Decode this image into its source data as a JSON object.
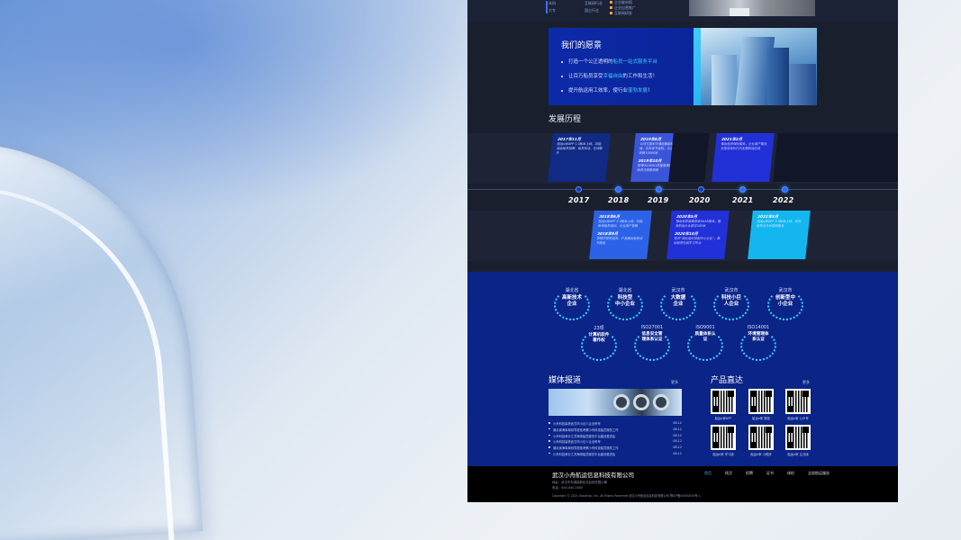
{
  "top": {
    "left_items": [
      "本科",
      "大专"
    ],
    "mid_items": [
      "互联网行业",
      "国企行业"
    ],
    "right_items": [
      "企业能申报",
      "企业自营推广",
      "互联网研发"
    ]
  },
  "vision": {
    "title": "我们的愿景",
    "items": [
      {
        "pre": "打造一个公正透明的",
        "hl": "船员一站式服务平台",
        "post": ""
      },
      {
        "pre": "让百万船员享受",
        "hl": "幸福自由",
        "post": "的工作和生活！"
      },
      {
        "pre": "提升航运用工效率，使行业",
        "hl": "蓬勃发展",
        "post": "！"
      }
    ]
  },
  "history": {
    "title": "发展历程",
    "years": [
      "2017",
      "2018",
      "2019",
      "2020",
      "2021",
      "2022"
    ],
    "top_cards": [
      {
        "lines": [
          {
            "date": "2017年11月",
            "text": "船运e家APP 1.0版本上线，功能涵盖船员招聘、船员找活、在线聊天"
          },
          {
            "date": "",
            "text": ""
          }
        ]
      },
      {
        "lines": [
          {
            "date": "2019年6月",
            "text": "公司与国家交通运输部船员证书对接，实现证书查验，企业用户数量突破10000家"
          },
          {
            "date": "2019年10月",
            "text": "取得ISO9001质量管理体系认证，船员注册数突破"
          }
        ]
      },
      {
        "lines": [
          {
            "date": "2021年2月",
            "text": "推出船员保险服务，企业用户覆盖全国沿海及内河主要航运区域"
          },
          {
            "date": "",
            "text": ""
          }
        ]
      }
    ],
    "bottom_cards": [
      {
        "lines": [
          {
            "date": "2018年6月",
            "text": "船运e家APP 2.0版本上线，功能新增船员培训、企业用户管理"
          },
          {
            "date": "2018年9月",
            "text": "获得天使轮融资，产品推出船员证书服务"
          }
        ]
      },
      {
        "lines": [
          {
            "date": "2020年5月",
            "text": "推出船员管理系统SAAS版本，服务航运企业超过500家"
          },
          {
            "date": "2020年10月",
            "text": "获评“湖北省科技型中小企业”，推出船员在线学习平台"
          }
        ]
      },
      {
        "lines": [
          {
            "date": "2022年3月",
            "text": "船运e家APP 3.0版本上线，实现船员全生命周期服务"
          },
          {
            "date": "",
            "text": ""
          }
        ]
      }
    ]
  },
  "honors": {
    "row1": [
      {
        "city": "湖北省",
        "name1": "高新技术",
        "name2": "企业"
      },
      {
        "city": "湖北省",
        "name1": "科技型",
        "name2": "中小企业"
      },
      {
        "city": "武汉市",
        "name1": "大数据",
        "name2": "企业"
      },
      {
        "city": "武汉市",
        "name1": "科技小巨",
        "name2": "人企业"
      },
      {
        "city": "武汉市",
        "name1": "创新型中",
        "name2": "小企业"
      }
    ],
    "row2": [
      {
        "city": "23项",
        "name1": "计算机软件",
        "name2": "著作权"
      },
      {
        "city": "ISO27001",
        "name1": "信息安全管",
        "name2": "理体系认证"
      },
      {
        "city": "ISO9001",
        "name1": "质量体系认",
        "name2": "证"
      },
      {
        "city": "ISO14001",
        "name1": "环境管理体",
        "name2": "系认证"
      }
    ]
  },
  "media": {
    "title": "媒体报道",
    "more": "更多",
    "news": [
      {
        "title": "小舟科技喜获武汉市小巨人企业称号",
        "date": "08-12"
      },
      {
        "title": "湖北省海事局领导莅临考察小舟科技船员服务工作",
        "date": "08-12"
      },
      {
        "title": "小舟科技承办江苏海事船员服务平台建设推进会",
        "date": "08-12"
      },
      {
        "title": "小舟科技喜获武汉市小巨人企业称号",
        "date": "08-12"
      },
      {
        "title": "湖北省海事局领导莅临考察小舟科技船员服务工作",
        "date": "08-12"
      },
      {
        "title": "小舟科技承办江苏海事船员服务平台建设推进会",
        "date": "08-12"
      }
    ]
  },
  "products": {
    "title": "产品直达",
    "more": "更多",
    "qrcodes": [
      "船运e家APP",
      "船运e家 微信",
      "船运e家 公众号",
      "船运e家 学习版",
      "船运e家 小程序",
      "船运e家 企业版"
    ]
  },
  "footer": {
    "company": "武汉小舟航运信息科技有限公司",
    "address": "地址：武汉市东湖高新区光谷软件园六期",
    "tel": "电话：400-000-0000",
    "copyright": "Copyright © 2021 Xiaozhou, Inc. All Rights Reserved    武汉小舟航运信息科技有限公司    鄂ICP备00000000号-1",
    "nav": [
      "首页",
      "找活",
      "招聘",
      "证书",
      "体检",
      "全部航运服务"
    ]
  },
  "colors": {
    "page_bg": "#1a1f2e",
    "vision_bg": "#0c2aa8",
    "accent": "#42c8ff",
    "honors_bg": "#0b2487",
    "footer_bg": "#000000"
  }
}
